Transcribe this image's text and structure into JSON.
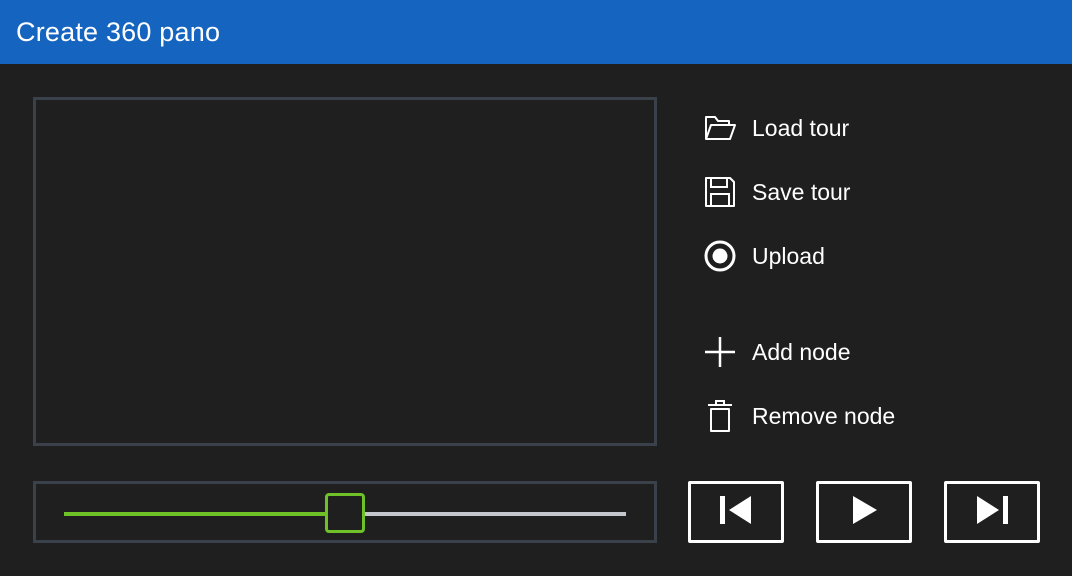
{
  "window": {
    "title": "Create 360 pano"
  },
  "actions": {
    "load": {
      "label": "Load tour",
      "icon": "folder-open-icon"
    },
    "save": {
      "label": "Save tour",
      "icon": "floppy-disk-icon"
    },
    "upload": {
      "label": "Upload",
      "icon": "radio-target-icon"
    },
    "add_node": {
      "label": "Add node",
      "icon": "plus-icon"
    },
    "remove_node": {
      "label": "Remove node",
      "icon": "trash-icon"
    }
  },
  "slider": {
    "value_fraction": 0.5
  },
  "playback": {
    "previous": {
      "icon": "skip-previous-icon"
    },
    "play": {
      "icon": "play-icon"
    },
    "next": {
      "icon": "skip-next-icon"
    }
  },
  "colors": {
    "title_bar": "#1565c0",
    "background": "#1f1f1f",
    "panel_border": "#3a414a",
    "slider_accent": "#6ec228",
    "slider_track": "#c4c8ce"
  }
}
